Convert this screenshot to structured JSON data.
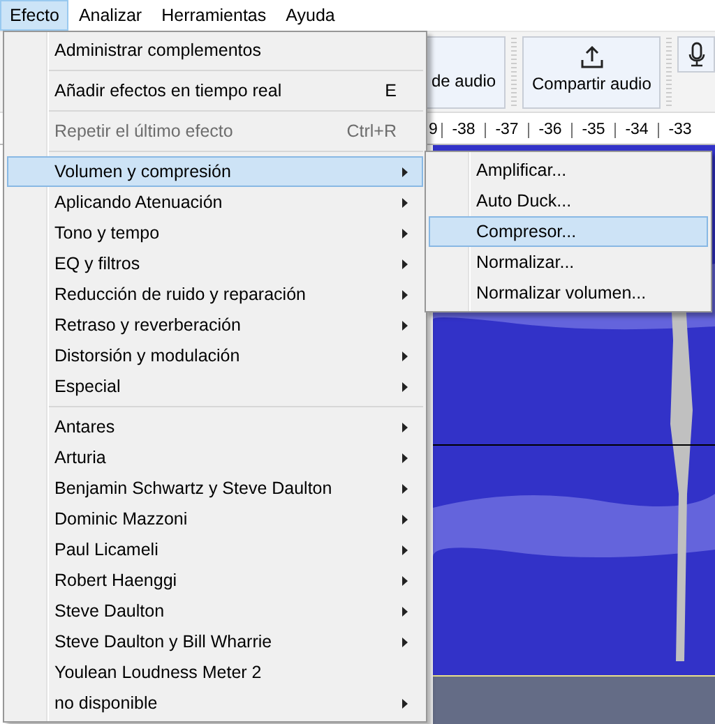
{
  "menubar": [
    {
      "label": "Efecto",
      "selected": true
    },
    {
      "label": "Analizar",
      "selected": false
    },
    {
      "label": "Herramientas",
      "selected": false
    },
    {
      "label": "Ayuda",
      "selected": false
    }
  ],
  "toolbar": {
    "partial_button": "de audio",
    "share_button": "Compartir audio"
  },
  "ruler": {
    "ticks": [
      "9",
      "-38",
      "-37",
      "-36",
      "-35",
      "-34",
      "-33"
    ]
  },
  "menu": [
    {
      "kind": "item",
      "label": "Administrar complementos",
      "disabled": false,
      "submenu": false,
      "selected": false
    },
    {
      "kind": "separator"
    },
    {
      "kind": "item",
      "label": "Añadir efectos en tiempo real",
      "shortcut": "E",
      "disabled": false,
      "submenu": false,
      "selected": false
    },
    {
      "kind": "separator"
    },
    {
      "kind": "item",
      "label": "Repetir el último efecto",
      "shortcut": "Ctrl+R",
      "disabled": true,
      "submenu": false,
      "selected": false
    },
    {
      "kind": "separator"
    },
    {
      "kind": "item",
      "label": "Volumen y compresión",
      "disabled": false,
      "submenu": true,
      "selected": true
    },
    {
      "kind": "item",
      "label": "Aplicando Atenuación",
      "disabled": false,
      "submenu": true,
      "selected": false
    },
    {
      "kind": "item",
      "label": "Tono y tempo",
      "disabled": false,
      "submenu": true,
      "selected": false
    },
    {
      "kind": "item",
      "label": "EQ y filtros",
      "disabled": false,
      "submenu": true,
      "selected": false
    },
    {
      "kind": "item",
      "label": "Reducción de ruido y reparación",
      "disabled": false,
      "submenu": true,
      "selected": false
    },
    {
      "kind": "item",
      "label": "Retraso y reverberación",
      "disabled": false,
      "submenu": true,
      "selected": false
    },
    {
      "kind": "item",
      "label": "Distorsión y modulación",
      "disabled": false,
      "submenu": true,
      "selected": false
    },
    {
      "kind": "item",
      "label": "Especial",
      "disabled": false,
      "submenu": true,
      "selected": false
    },
    {
      "kind": "separator"
    },
    {
      "kind": "item",
      "label": "Antares",
      "disabled": false,
      "submenu": true,
      "selected": false
    },
    {
      "kind": "item",
      "label": "Arturia",
      "disabled": false,
      "submenu": true,
      "selected": false
    },
    {
      "kind": "item",
      "label": "Benjamin Schwartz y Steve Daulton",
      "disabled": false,
      "submenu": true,
      "selected": false
    },
    {
      "kind": "item",
      "label": "Dominic Mazzoni",
      "disabled": false,
      "submenu": true,
      "selected": false
    },
    {
      "kind": "item",
      "label": "Paul Licameli",
      "disabled": false,
      "submenu": true,
      "selected": false
    },
    {
      "kind": "item",
      "label": "Robert Haenggi",
      "disabled": false,
      "submenu": true,
      "selected": false
    },
    {
      "kind": "item",
      "label": "Steve Daulton",
      "disabled": false,
      "submenu": true,
      "selected": false
    },
    {
      "kind": "item",
      "label": "Steve Daulton y Bill Wharrie",
      "disabled": false,
      "submenu": true,
      "selected": false
    },
    {
      "kind": "item",
      "label": "Youlean Loudness Meter 2",
      "disabled": false,
      "submenu": false,
      "selected": false
    },
    {
      "kind": "item",
      "label": "no disponible",
      "disabled": false,
      "submenu": true,
      "selected": false
    }
  ],
  "submenu": [
    {
      "label": "Amplificar...",
      "selected": false
    },
    {
      "label": "Auto Duck...",
      "selected": false
    },
    {
      "label": "Compresor...",
      "selected": true
    },
    {
      "label": "Normalizar...",
      "selected": false
    },
    {
      "label": "Normalizar volumen...",
      "selected": false
    }
  ]
}
